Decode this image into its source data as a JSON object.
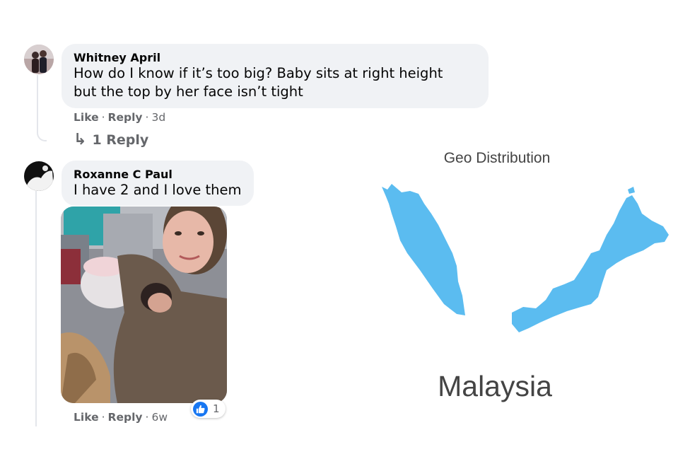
{
  "comments": [
    {
      "author": "Whitney April",
      "text": "How do I know if it’s too big? Baby sits at right height\nbut the top by her face isn’t tight",
      "like_label": "Like",
      "reply_label": "Reply",
      "time": "3d",
      "view_replies_label": "1 Reply"
    },
    {
      "author": "Roxanne C Paul",
      "text": "I have 2 and I love them",
      "like_label": "Like",
      "reply_label": "Reply",
      "time": "6w",
      "reaction_count": "1",
      "reaction_icon": "like-icon"
    }
  ],
  "geo": {
    "title": "Geo Distribution",
    "country": "Malaysia",
    "map_color": "#5bbcf0"
  },
  "colors": {
    "bubble": "#f0f2f5",
    "secondary_text": "#65676b",
    "like_blue": "#1877f2"
  }
}
